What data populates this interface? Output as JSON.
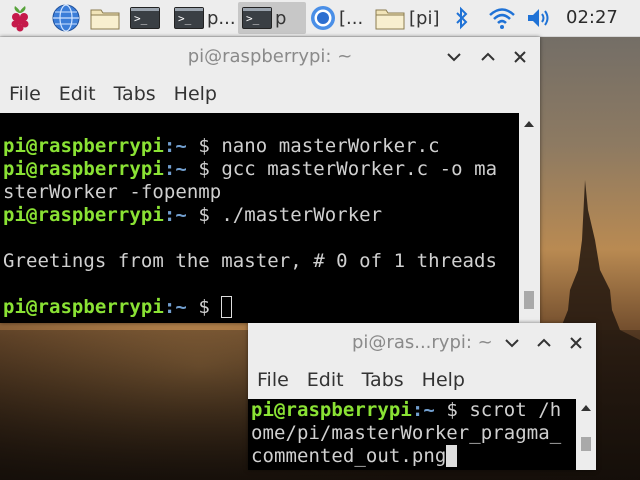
{
  "taskbar": {
    "launchers": [
      {
        "icon": "raspberry-menu-icon"
      },
      {
        "icon": "web-browser-icon"
      },
      {
        "icon": "file-manager-icon"
      },
      {
        "icon": "terminal-icon"
      }
    ],
    "apps": [
      {
        "icon": "terminal-icon",
        "label": "p..."
      },
      {
        "icon": "terminal-icon",
        "label": "p"
      },
      {
        "icon": "chromium-icon",
        "label": "[..."
      },
      {
        "icon": "folder-icon",
        "label": "[pi]"
      }
    ],
    "tray": [
      "bluetooth-icon",
      "wifi-icon",
      "volume-icon"
    ],
    "clock": "02:27"
  },
  "window1": {
    "title": "pi@raspberrypi: ~",
    "menu": [
      "File",
      "Edit",
      "Tabs",
      "Help"
    ],
    "lines": [
      {
        "user": "pi@raspberrypi",
        "path": ":~",
        "prompt": " $",
        "cmd": " nano masterWorker.c"
      },
      {
        "user": "pi@raspberrypi",
        "path": ":~",
        "prompt": " $",
        "cmd": " gcc masterWorker.c -o ma"
      },
      {
        "text": "sterWorker -fopenmp"
      },
      {
        "user": "pi@raspberrypi",
        "path": ":~",
        "prompt": " $",
        "cmd": " ./masterWorker"
      },
      {
        "text": ""
      },
      {
        "text": "Greetings from the master, # 0 of 1 threads"
      },
      {
        "text": ""
      },
      {
        "user": "pi@raspberrypi",
        "path": ":~",
        "prompt": " $",
        "cmd": " "
      }
    ]
  },
  "window2": {
    "title": "pi@ras...rypi: ~",
    "menu": [
      "File",
      "Edit",
      "Tabs",
      "Help"
    ],
    "lines": [
      {
        "user": "pi@raspberrypi",
        "path": ":~",
        "prompt": " $",
        "cmd": " scrot /h"
      },
      {
        "text": "ome/pi/masterWorker_pragma_"
      },
      {
        "text": "commented_out.png"
      }
    ]
  },
  "colors": {
    "prompt_user": "#8ae234",
    "prompt_path": "#729fcf",
    "terminal_bg": "#000000",
    "title_inactive": "#8a8a8a"
  }
}
